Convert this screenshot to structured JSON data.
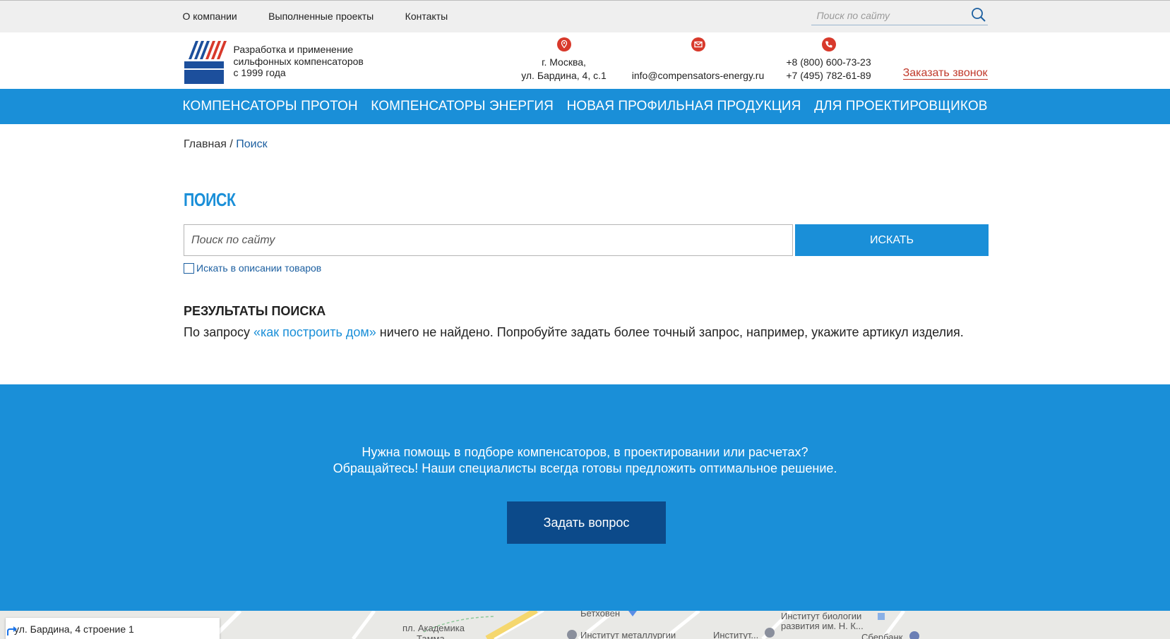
{
  "topnav": {
    "items": [
      "О компании",
      "Выполненные проекты",
      "Контакты"
    ],
    "search_placeholder": "Поиск по сайту"
  },
  "header": {
    "tagline": [
      "Разработка и применение",
      "сильфонных компенсаторов",
      "с 1999 года"
    ],
    "address": [
      "г. Москва,",
      "ул. Бардина, 4, с.1"
    ],
    "email": "info@compensators-energy.ru",
    "phones": [
      "+8 (800) 600-73-23",
      "+7 (495) 782-61-89"
    ],
    "callback_label": "Заказать звонок"
  },
  "mainnav": {
    "items": [
      "Компенсаторы Протон",
      "Компенсаторы Энергия",
      "Новая профильная продукция",
      "Для проектировщиков"
    ]
  },
  "breadcrumb": {
    "home": "Главная",
    "separator": "/",
    "current": "Поиск"
  },
  "page_title": "ПОИСК",
  "search": {
    "placeholder": "Поиск по сайту",
    "button_label": "ИСКАТЬ",
    "checkbox_label": "Искать в описании товаров",
    "checkbox_checked": false
  },
  "results": {
    "title": "Результаты поиска",
    "prefix": "По запросу ",
    "query": "«как построить дом»",
    "suffix": " ничего не найдено. Попробуйте задать более точный запрос, например, укажите артикул изделия."
  },
  "help": {
    "line1": "Нужна помощь в подборе компенсаторов, в проектировании или расчетах?",
    "line2": "Обращайтесь! Наши специалисты всегда готовы предложить оптимальное решение.",
    "button_label": "Задать вопрос"
  },
  "map": {
    "card_address": "ул. Бардина, 4 строение 1",
    "labels": [
      "пл. Академика",
      "Тамма",
      "Бетховен",
      "Институт металлургии",
      "Институт...",
      "Институт биологии",
      "развития им. Н. К...",
      "Сбербанк"
    ]
  },
  "colors": {
    "brand_blue": "#1a8fd8",
    "dark_blue": "#0c4a8a",
    "accent_red": "#c0392b",
    "link_blue": "#1c5fa0"
  }
}
